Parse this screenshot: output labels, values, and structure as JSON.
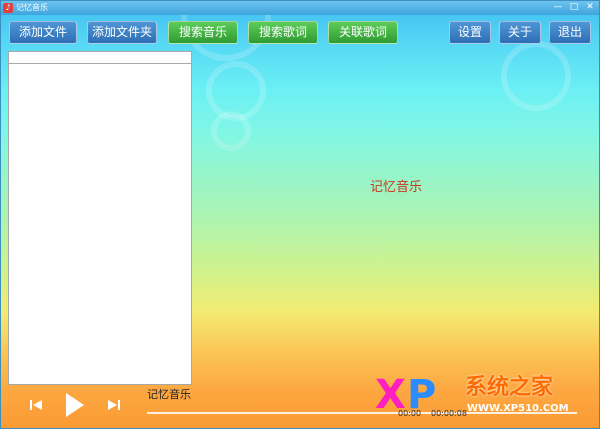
{
  "window": {
    "title": "记忆音乐",
    "minimize": "—",
    "maximize": "□",
    "close": "✕"
  },
  "toolbar": {
    "add_file": "添加文件",
    "add_folder": "添加文件夹",
    "search_music": "搜索音乐",
    "search_lyrics": "搜索歌词",
    "link_lyrics": "关联歌词",
    "settings": "设置",
    "about": "关于",
    "exit": "退出"
  },
  "main": {
    "center_title": "记忆音乐"
  },
  "player": {
    "now_playing": "记忆音乐",
    "current_time": "00:00",
    "total_time": "00:00:08"
  },
  "icons": {
    "prev": "skip-back-icon",
    "play": "play-icon",
    "next": "skip-forward-icon"
  },
  "watermark": {
    "x": "X",
    "p": "P",
    "brand": "系统之家",
    "url": "WWW.XP510.COM"
  }
}
